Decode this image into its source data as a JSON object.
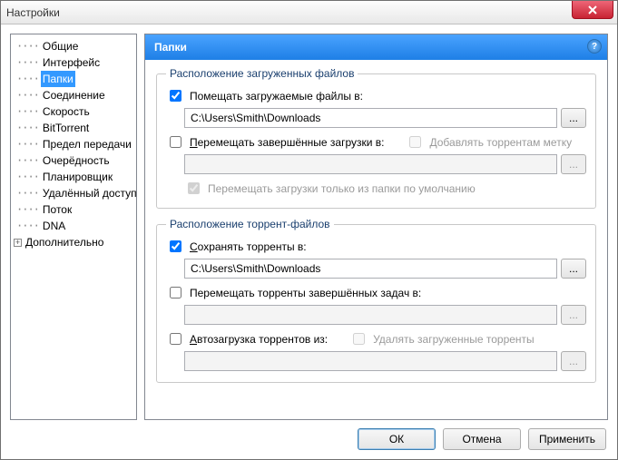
{
  "window": {
    "title": "Настройки"
  },
  "tree": {
    "items": [
      "Общие",
      "Интерфейс",
      "Папки",
      "Соединение",
      "Скорость",
      "BitTorrent",
      "Предел передачи",
      "Очерёдность",
      "Планировщик",
      "Удалённый доступ",
      "Поток",
      "DNA",
      "Дополнительно"
    ],
    "selected_index": 2,
    "expandable_index": 12
  },
  "panel": {
    "title": "Папки",
    "group_downloads": {
      "legend": "Расположение загруженных файлов",
      "put_in": {
        "checked": true,
        "label": "Помещать загружаемые файлы в:",
        "path": "C:\\Users\\Smith\\Downloads"
      },
      "move_done": {
        "checked": false,
        "label": "Перемещать завершённые загрузки в:",
        "label2": "Добавлять торрентам метку",
        "path": ""
      },
      "only_default": {
        "checked": true,
        "label": "Перемещать загрузки только из папки по умолчанию"
      }
    },
    "group_torrents": {
      "legend": "Расположение торрент-файлов",
      "save": {
        "checked": true,
        "label": "Сохранять торренты в:",
        "path": "C:\\Users\\Smith\\Downloads"
      },
      "move_finished": {
        "checked": false,
        "label": "Перемещать торренты завершённых задач в:",
        "path": ""
      },
      "autoload": {
        "checked": false,
        "label": "Автозагрузка торрентов из:",
        "label2": "Удалять загруженные торренты",
        "path": ""
      }
    }
  },
  "buttons": {
    "ok": "ОК",
    "cancel": "Отмена",
    "apply": "Применить"
  },
  "browse_label": "..."
}
